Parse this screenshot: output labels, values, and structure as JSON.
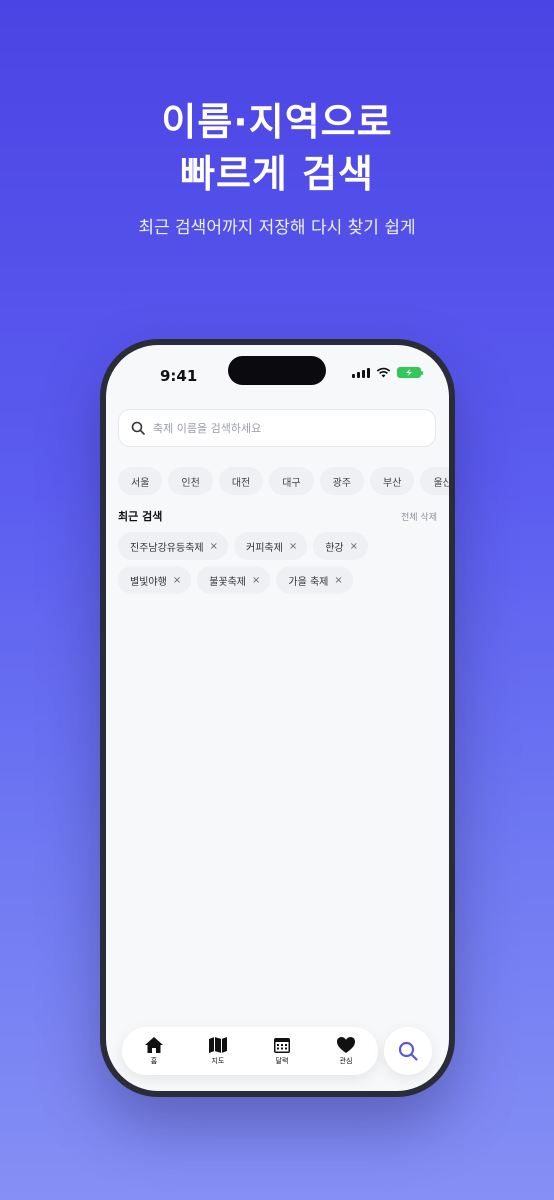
{
  "hero": {
    "title_line1": "이름·지역으로",
    "title_line2": "빠르게 검색",
    "subtitle": "최근 검색어까지 저장해 다시 찾기 쉽게"
  },
  "status_bar": {
    "time": "9:41"
  },
  "search": {
    "placeholder": "축제 이름을 검색하세요",
    "value": ""
  },
  "regions": [
    "서울",
    "인천",
    "대전",
    "대구",
    "광주",
    "부산",
    "울산"
  ],
  "recent": {
    "title": "최근 검색",
    "clear_all": "전체 삭제",
    "items": [
      "진주남강유등축제",
      "커피축제",
      "한강",
      "별빛야행",
      "불꽃축제",
      "가을 축제"
    ],
    "remove_glyph": "×"
  },
  "tabbar": {
    "items": [
      {
        "label": "홈",
        "icon": "home-icon"
      },
      {
        "label": "지도",
        "icon": "map-icon"
      },
      {
        "label": "달력",
        "icon": "calendar-icon"
      },
      {
        "label": "관심",
        "icon": "heart-icon"
      }
    ],
    "search_icon": "search-icon"
  },
  "colors": {
    "background_top": "#4b44e4",
    "background_bottom": "#858ff4",
    "accent": "#5a5ad6",
    "chip_bg": "#eef0f4"
  }
}
